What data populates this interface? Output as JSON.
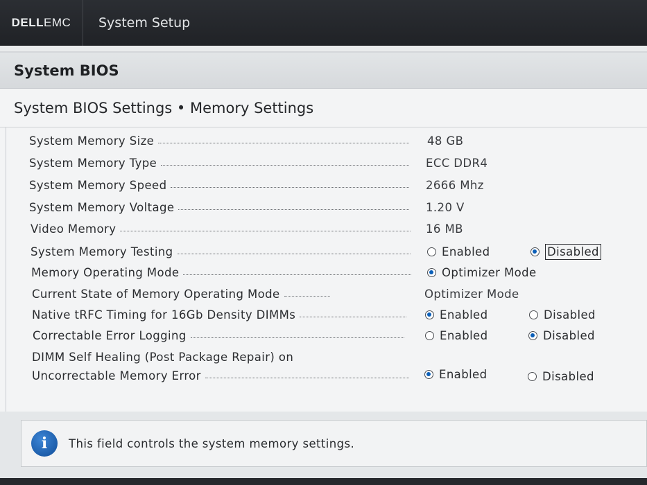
{
  "header": {
    "brand_left": "DELL",
    "brand_right": "EMC",
    "app_title": "System Setup"
  },
  "panel": {
    "title": "System BIOS",
    "subtitle": "System BIOS Settings • Memory Settings"
  },
  "settings": {
    "memory_size": {
      "label": "System Memory Size",
      "value": "48 GB"
    },
    "memory_type": {
      "label": "System Memory Type",
      "value": "ECC DDR4"
    },
    "memory_speed": {
      "label": "System Memory Speed",
      "value": "2666 Mhz"
    },
    "memory_voltage": {
      "label": "System Memory Voltage",
      "value": "1.20 V"
    },
    "video_memory": {
      "label": "Video Memory",
      "value": "16 MB"
    },
    "memory_testing": {
      "label": "System Memory Testing",
      "opt1": "Enabled",
      "opt2": "Disabled",
      "selected": "Disabled"
    },
    "operating_mode": {
      "label": "Memory Operating Mode",
      "opt1": "Optimizer Mode",
      "selected": "Optimizer Mode"
    },
    "current_mode": {
      "label": "Current State of Memory Operating Mode",
      "value": "Optimizer Mode"
    },
    "trfc_timing": {
      "label": "Native tRFC Timing for 16Gb Density DIMMs",
      "opt1": "Enabled",
      "opt2": "Disabled",
      "selected": "Enabled"
    },
    "error_logging": {
      "label": "Correctable Error Logging",
      "opt1": "Enabled",
      "opt2": "Disabled",
      "selected": "Disabled"
    },
    "self_healing": {
      "label_line1": "DIMM Self Healing (Post Package Repair) on",
      "label_line2": "Uncorrectable Memory Error",
      "opt1": "Enabled",
      "opt2": "Disabled",
      "selected": "Enabled"
    }
  },
  "info": {
    "icon": "info-icon",
    "text": "This field controls the system memory settings."
  },
  "colors": {
    "radio_selected": "#0b5fb8",
    "topbar": "#26282c"
  }
}
